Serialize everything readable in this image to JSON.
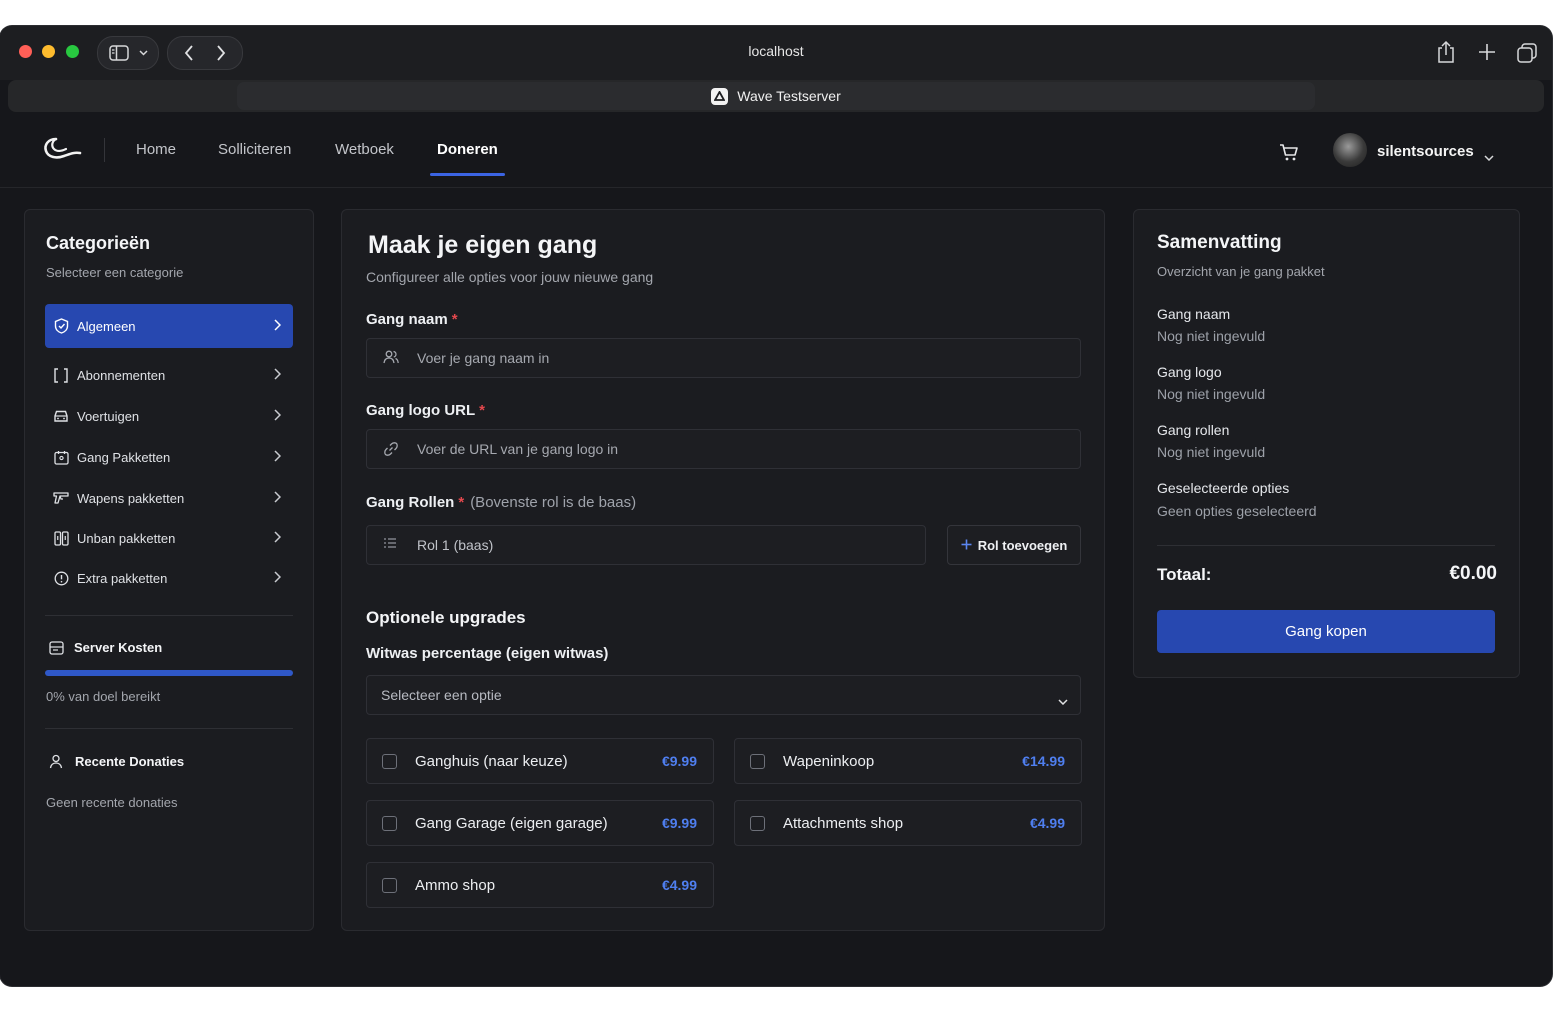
{
  "browser": {
    "address": "localhost",
    "tab_title": "Wave Testserver"
  },
  "nav": {
    "links": [
      "Home",
      "Solliciteren",
      "Wetboek",
      "Doneren"
    ],
    "active": "Doneren",
    "username": "silentsources"
  },
  "categories": {
    "title": "Categorieën",
    "subtitle": "Selecteer een categorie",
    "items": [
      {
        "label": "Algemeen",
        "icon": "shield-icon",
        "active": true
      },
      {
        "label": "Abonnementen",
        "icon": "bracket-frame-icon",
        "active": false
      },
      {
        "label": "Voertuigen",
        "icon": "car-icon",
        "active": false
      },
      {
        "label": "Gang Pakketten",
        "icon": "calendar-users-icon",
        "active": false
      },
      {
        "label": "Wapens pakketten",
        "icon": "gun-icon",
        "active": false
      },
      {
        "label": "Unban pakketten",
        "icon": "unlock-box-icon",
        "active": false
      },
      {
        "label": "Extra pakketten",
        "icon": "alert-circle-icon",
        "active": false
      }
    ],
    "server_costs": {
      "title": "Server Kosten",
      "progress_percent": 0,
      "progress_text": "0% van doel bereikt"
    },
    "recent_donations": {
      "title": "Recente Donaties",
      "empty_text": "Geen recente donaties"
    }
  },
  "form": {
    "title": "Maak je eigen gang",
    "subtitle": "Configureer alle opties voor jouw nieuwe gang",
    "gang_name": {
      "label": "Gang naam",
      "required": "*",
      "placeholder": "Voer je gang naam in"
    },
    "gang_logo": {
      "label": "Gang logo URL",
      "required": "*",
      "placeholder": "Voer de URL van je gang logo in"
    },
    "gang_roles": {
      "label": "Gang Rollen",
      "required": "*",
      "hint": "(Bovenste rol is de baas)",
      "role1_value": "Rol 1 (baas)",
      "add_button": "Rol toevoegen"
    },
    "upgrades_title": "Optionele upgrades",
    "witwas": {
      "label": "Witwas percentage (eigen witwas)",
      "selected": "Selecteer een optie"
    },
    "options": [
      {
        "label": "Ganghuis (naar keuze)",
        "price": "€9.99",
        "checked": false
      },
      {
        "label": "Wapeninkoop",
        "price": "€14.99",
        "checked": false
      },
      {
        "label": "Gang Garage (eigen garage)",
        "price": "€9.99",
        "checked": false
      },
      {
        "label": "Attachments shop",
        "price": "€4.99",
        "checked": false
      },
      {
        "label": "Ammo shop",
        "price": "€4.99",
        "checked": false
      }
    ]
  },
  "summary": {
    "title": "Samenvatting",
    "subtitle": "Overzicht van je gang pakket",
    "rows": [
      {
        "label": "Gang naam",
        "value": "Nog niet ingevuld"
      },
      {
        "label": "Gang logo",
        "value": "Nog niet ingevuld"
      },
      {
        "label": "Gang rollen",
        "value": "Nog niet ingevuld"
      },
      {
        "label": "Geselecteerde opties",
        "value": "Geen opties geselecteerd"
      }
    ],
    "total_label": "Totaal:",
    "total_value": "€0.00",
    "buy_button": "Gang kopen"
  },
  "colors": {
    "accent": "#2748b0",
    "price": "#4f7ff0",
    "required": "#e5484d",
    "background": "#16171b",
    "card": "#1b1c20"
  }
}
